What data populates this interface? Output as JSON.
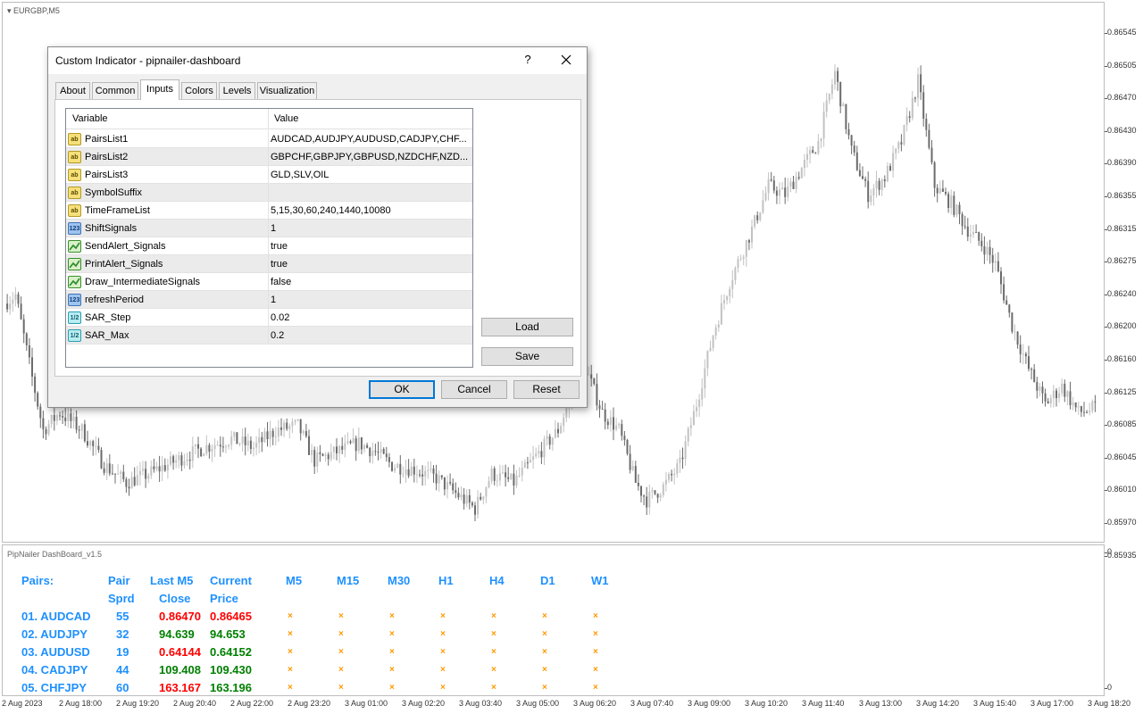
{
  "chart": {
    "symbol_title": "EURGBP,M5",
    "price_ticks": [
      "0.86545",
      "0.86505",
      "0.86470",
      "0.86430",
      "0.86390",
      "0.86355",
      "0.86315",
      "0.86275",
      "0.86240",
      "0.86200",
      "0.86160",
      "0.86125",
      "0.86085",
      "0.86045",
      "0.86010",
      "0.85970",
      "0.85935"
    ],
    "time_ticks": [
      "2 Aug 2023",
      "2 Aug 18:00",
      "2 Aug 19:20",
      "2 Aug 20:40",
      "2 Aug 22:00",
      "2 Aug 23:20",
      "3 Aug 01:00",
      "3 Aug 02:20",
      "3 Aug 03:40",
      "3 Aug 05:00",
      "3 Aug 06:20",
      "3 Aug 07:40",
      "3 Aug 09:00",
      "3 Aug 10:20",
      "3 Aug 11:40",
      "3 Aug 13:00",
      "3 Aug 14:20",
      "3 Aug 15:40",
      "3 Aug 17:00",
      "3 Aug 18:20"
    ],
    "colors": {
      "bull": "#c2c2c2",
      "bear": "#6b6b6b"
    }
  },
  "chart_data": {
    "type": "candlestick",
    "title": "EURGBP,M5",
    "ylim": [
      0.8593,
      0.8655
    ],
    "close_path": [
      [
        0,
        0.86205
      ],
      [
        4,
        0.86215
      ],
      [
        10,
        0.8612
      ],
      [
        14,
        0.8606
      ],
      [
        20,
        0.8608
      ],
      [
        28,
        0.8606
      ],
      [
        36,
        0.8602
      ],
      [
        44,
        0.86
      ],
      [
        52,
        0.8601
      ],
      [
        62,
        0.86025
      ],
      [
        72,
        0.8604
      ],
      [
        82,
        0.8605
      ],
      [
        90,
        0.8604
      ],
      [
        98,
        0.8606
      ],
      [
        106,
        0.86065
      ],
      [
        112,
        0.86025
      ],
      [
        120,
        0.86035
      ],
      [
        128,
        0.86045
      ],
      [
        134,
        0.86035
      ],
      [
        140,
        0.8602
      ],
      [
        148,
        0.86015
      ],
      [
        156,
        0.86005
      ],
      [
        164,
        0.85985
      ],
      [
        170,
        0.8597
      ],
      [
        176,
        0.8601
      ],
      [
        184,
        0.86
      ],
      [
        192,
        0.8603
      ],
      [
        200,
        0.8606
      ],
      [
        206,
        0.8611
      ],
      [
        210,
        0.8613
      ],
      [
        216,
        0.8608
      ],
      [
        222,
        0.8606
      ],
      [
        228,
        0.86
      ],
      [
        232,
        0.8598
      ],
      [
        238,
        0.85995
      ],
      [
        244,
        0.8602
      ],
      [
        250,
        0.8609
      ],
      [
        256,
        0.8617
      ],
      [
        262,
        0.8623
      ],
      [
        270,
        0.8629
      ],
      [
        276,
        0.8634
      ],
      [
        282,
        0.8633
      ],
      [
        288,
        0.8636
      ],
      [
        294,
        0.8639
      ],
      [
        300,
        0.8647
      ],
      [
        306,
        0.8638
      ],
      [
        312,
        0.8633
      ],
      [
        318,
        0.8635
      ],
      [
        324,
        0.8639
      ],
      [
        330,
        0.8646
      ],
      [
        336,
        0.8634
      ],
      [
        342,
        0.8632
      ],
      [
        348,
        0.8629
      ],
      [
        354,
        0.8627
      ],
      [
        358,
        0.8625
      ],
      [
        364,
        0.8618
      ],
      [
        370,
        0.8613
      ],
      [
        376,
        0.8609
      ],
      [
        382,
        0.8611
      ],
      [
        388,
        0.8608
      ],
      [
        394,
        0.86085
      ]
    ]
  },
  "dashboard": {
    "title": "PipNailer DashBoard_v1.5",
    "scale_top": "0",
    "scale_bottom": "0",
    "headers": {
      "pairs": "Pairs:",
      "pair_line1": "Pair",
      "pair_line2": "Sprd",
      "last_line1": "Last M5",
      "last_line2": "Close",
      "current_line1": "Current",
      "current_line2": "Price",
      "timeframes": [
        "M5",
        "M15",
        "M30",
        "H1",
        "H4",
        "D1",
        "W1"
      ]
    },
    "signal_mark": "×",
    "rows": [
      {
        "pair": "01. AUDCAD",
        "spread": "55",
        "last_close": "0.86470",
        "last_color": "red",
        "current": "0.86465",
        "current_color": "red"
      },
      {
        "pair": "02. AUDJPY",
        "spread": "32",
        "last_close": "94.639",
        "last_color": "green",
        "current": "94.653",
        "current_color": "green"
      },
      {
        "pair": "03. AUDUSD",
        "spread": "19",
        "last_close": "0.64144",
        "last_color": "red",
        "current": "0.64152",
        "current_color": "green"
      },
      {
        "pair": "04. CADJPY",
        "spread": "44",
        "last_close": "109.408",
        "last_color": "green",
        "current": "109.430",
        "current_color": "green"
      },
      {
        "pair": "05. CHFJPY",
        "spread": "60",
        "last_close": "163.167",
        "last_color": "red",
        "current": "163.196",
        "current_color": "green"
      }
    ]
  },
  "dialog": {
    "title": "Custom Indicator - pipnailer-dashboard",
    "help_glyph": "?",
    "tabs": [
      "About",
      "Common",
      "Inputs",
      "Colors",
      "Levels",
      "Visualization"
    ],
    "active_tab": "Inputs",
    "grid": {
      "col_variable": "Variable",
      "col_value": "Value",
      "rows": [
        {
          "type": "ab",
          "icon_text": "ab",
          "variable": "PairsList1",
          "value": "AUDCAD,AUDJPY,AUDUSD,CADJPY,CHF..."
        },
        {
          "type": "ab",
          "icon_text": "ab",
          "variable": "PairsList2",
          "value": "GBPCHF,GBPJPY,GBPUSD,NZDCHF,NZD..."
        },
        {
          "type": "ab",
          "icon_text": "ab",
          "variable": "PairsList3",
          "value": "GLD,SLV,OIL"
        },
        {
          "type": "ab",
          "icon_text": "ab",
          "variable": "SymbolSuffix",
          "value": ""
        },
        {
          "type": "ab",
          "icon_text": "ab",
          "variable": "TimeFrameList",
          "value": "5,15,30,60,240,1440,10080"
        },
        {
          "type": "num",
          "icon_text": "123",
          "variable": "ShiftSignals",
          "value": "1"
        },
        {
          "type": "bool",
          "icon_text": "",
          "variable": "SendAlert_Signals",
          "value": "true"
        },
        {
          "type": "bool",
          "icon_text": "",
          "variable": "PrintAlert_Signals",
          "value": "true"
        },
        {
          "type": "bool",
          "icon_text": "",
          "variable": "Draw_IntermediateSignals",
          "value": "false"
        },
        {
          "type": "num",
          "icon_text": "123",
          "variable": "refreshPeriod",
          "value": "1"
        },
        {
          "type": "real",
          "icon_text": "1/2",
          "variable": "SAR_Step",
          "value": "0.02"
        },
        {
          "type": "real",
          "icon_text": "1/2",
          "variable": "SAR_Max",
          "value": "0.2"
        }
      ]
    },
    "buttons": {
      "load": "Load",
      "save": "Save",
      "ok": "OK",
      "cancel": "Cancel",
      "reset": "Reset"
    }
  }
}
